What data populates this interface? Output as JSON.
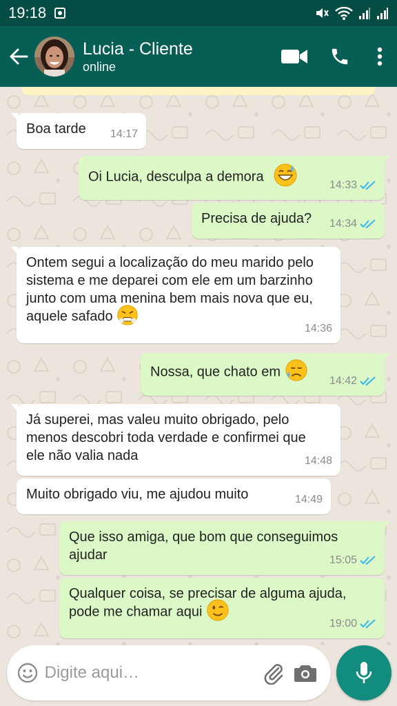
{
  "status_bar": {
    "time": "19:18",
    "icons": [
      "notification-icon",
      "mute-icon",
      "wifi-icon",
      "signal-icon-1",
      "signal-icon-2"
    ]
  },
  "header": {
    "back_icon": "arrow-left-icon",
    "contact_name": "Lucia - Cliente",
    "contact_status": "online",
    "actions": [
      "video-call-icon",
      "phone-icon",
      "more-vert-icon"
    ]
  },
  "messages": [
    {
      "dir": "in",
      "text": "Boa tarde",
      "time": "14:17"
    },
    {
      "dir": "out",
      "text": "Oi Lucia, desculpa a demora",
      "emoji": "grinning-sweat-emoji",
      "time": "14:33",
      "read": true
    },
    {
      "dir": "out",
      "text": "Precisa de ajuda?",
      "time": "14:34",
      "read": true
    },
    {
      "dir": "in",
      "text": "Ontem segui a localização do meu marido pelo sistema e me deparei com ele em um barzinho junto com uma menina bem mais nova que eu, aquele safado",
      "emoji": "steam-nose-emoji",
      "time": "14:36"
    },
    {
      "dir": "out",
      "text": "Nossa, que chato em",
      "emoji": "sad-sweat-emoji",
      "time": "14:42",
      "read": true
    },
    {
      "dir": "in",
      "text": "Já superei, mas valeu muito obrigado, pelo menos descobri toda verdade e confirmei que ele não valia nada",
      "time": "14:48"
    },
    {
      "dir": "in",
      "text": "Muito obrigado viu, me ajudou muito",
      "time": "14:49"
    },
    {
      "dir": "out",
      "text": "Que isso amiga, que bom que conseguimos ajudar",
      "time": "15:05",
      "read": true
    },
    {
      "dir": "out",
      "text": "Qualquer coisa, se precisar de alguma ajuda, pode me chamar aqui",
      "emoji": "winking-emoji",
      "time": "19:00",
      "read": true
    }
  ],
  "input": {
    "placeholder": "Digite aqui…",
    "value": ""
  },
  "colors": {
    "header": "#075e54",
    "status_bar": "#054d44",
    "outgoing": "#dcf8c6",
    "incoming": "#ffffff",
    "read_tick": "#34b7f1",
    "fab": "#128c7e"
  }
}
